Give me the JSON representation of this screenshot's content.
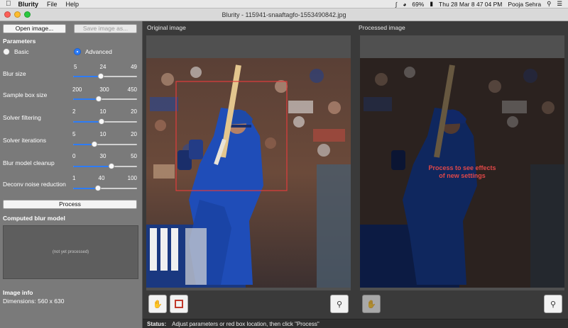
{
  "menubar": {
    "app_name": "Blurity",
    "items": [
      "File",
      "Help"
    ],
    "battery": "69%",
    "clock": "Thu 28 Mar  8 47 04 PM",
    "user": "Pooja Sehra"
  },
  "window": {
    "title": "Blurity - 115941-snaaftagfo-1553490842.jpg"
  },
  "left_panel": {
    "open_button": "Open image...",
    "save_button": "Save image as...",
    "parameters_title": "Parameters",
    "mode_basic": "Basic",
    "mode_advanced": "Advanced",
    "params": [
      {
        "label": "Blur size",
        "min": "5",
        "value": "24",
        "max": "49",
        "fraction": 0.43
      },
      {
        "label": "Sample box size",
        "min": "200",
        "value": "300",
        "max": "450",
        "fraction": 0.4
      },
      {
        "label": "Solver filtering",
        "min": "2",
        "value": "10",
        "max": "20",
        "fraction": 0.44
      },
      {
        "label": "Solver iterations",
        "min": "5",
        "value": "10",
        "max": "20",
        "fraction": 0.33
      },
      {
        "label": "Blur model cleanup",
        "min": "0",
        "value": "30",
        "max": "50",
        "fraction": 0.6
      },
      {
        "label": "Deconv noise reduction",
        "min": "1",
        "value": "40",
        "max": "100",
        "fraction": 0.39
      }
    ],
    "process_button": "Process",
    "computed_title": "Computed blur model",
    "computed_placeholder": "(not yet processed)",
    "image_info_title": "Image info",
    "dimensions": "Dimensions:   560 x 630"
  },
  "original_pane": {
    "title": "Original image"
  },
  "processed_pane": {
    "title": "Processed image",
    "overlay_line1": "Process to see effects",
    "overlay_line2": "of new settings"
  },
  "status": {
    "label": "Status:",
    "text": "Adjust parameters or red box location, then click \"Process\""
  },
  "colors": {
    "accent": "#2d7cf6",
    "selection_box": "#e03c3c",
    "overlay_text": "#e04848"
  }
}
